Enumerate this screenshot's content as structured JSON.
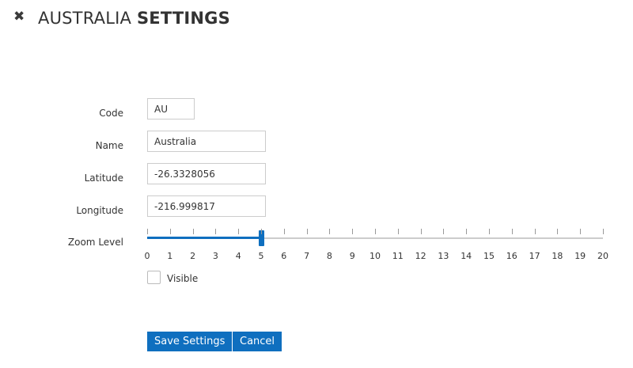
{
  "header": {
    "close_icon": "close-icon",
    "title_prefix": "AUSTRALIA",
    "title_bold": "SETTINGS"
  },
  "form": {
    "code": {
      "label": "Code",
      "value": "AU"
    },
    "name": {
      "label": "Name",
      "value": "Australia"
    },
    "latitude": {
      "label": "Latitude",
      "value": "-26.3328056"
    },
    "longitude": {
      "label": "Longitude",
      "value": "-216.999817"
    },
    "zoom": {
      "label": "Zoom Level",
      "min": 0,
      "max": 20,
      "value": 5,
      "ticks": [
        "0",
        "1",
        "2",
        "3",
        "4",
        "5",
        "6",
        "7",
        "8",
        "9",
        "10",
        "11",
        "12",
        "13",
        "14",
        "15",
        "16",
        "17",
        "18",
        "19",
        "20"
      ]
    },
    "visible": {
      "label": "Visible",
      "checked": false
    }
  },
  "actions": {
    "save_label": "Save Settings",
    "cancel_label": "Cancel"
  },
  "colors": {
    "accent": "#0f6fbf",
    "track": "#cccccc"
  }
}
